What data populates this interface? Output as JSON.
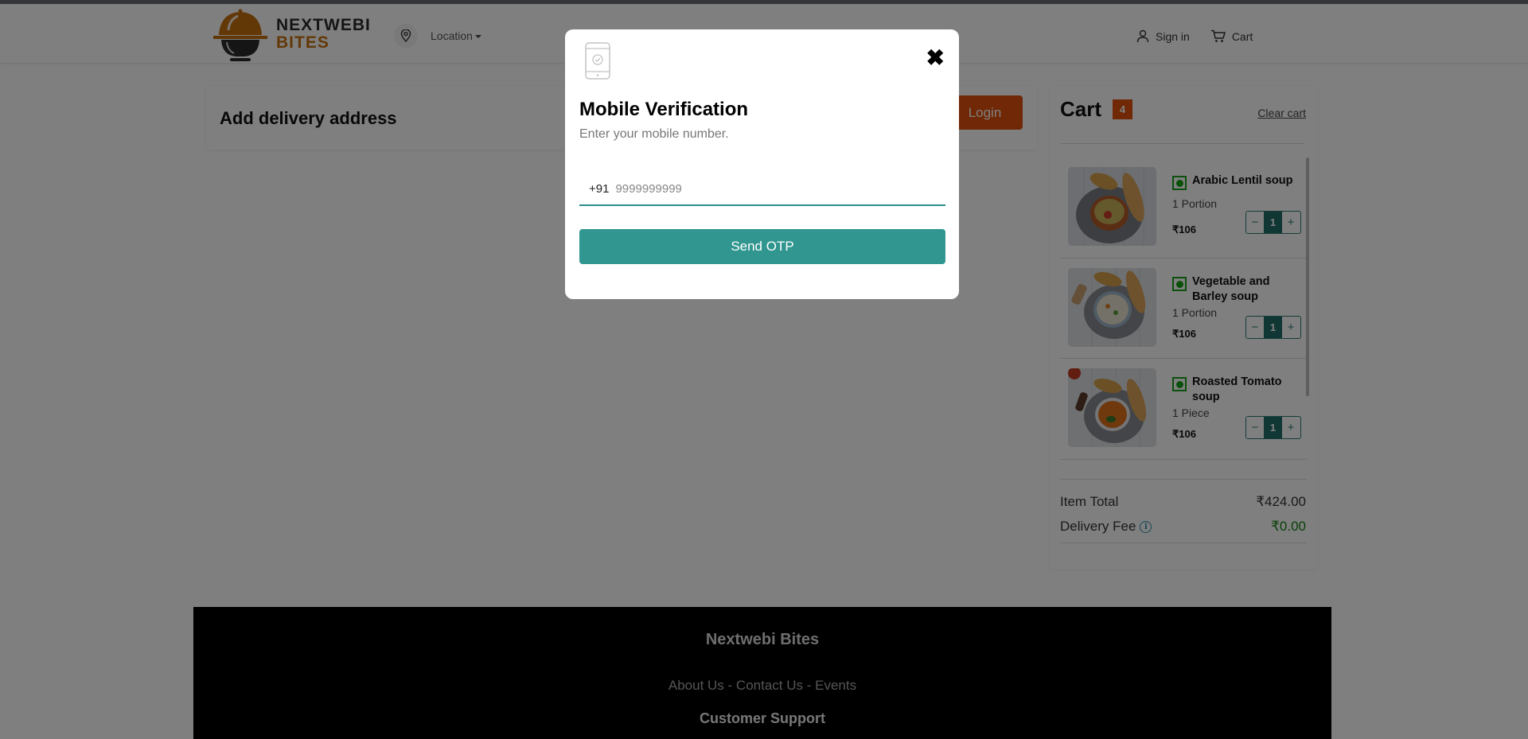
{
  "header": {
    "logo": {
      "line1": "NEXTWEBI",
      "line2": "BITES"
    },
    "location_label": "Location",
    "sign_in_label": "Sign in",
    "cart_label": "Cart"
  },
  "address": {
    "title": "Add delivery address",
    "login_label": "Login"
  },
  "cart": {
    "title": "Cart",
    "count": "4",
    "clear_label": "Clear cart",
    "items": [
      {
        "name": "Arabic Lentil soup",
        "unit": "1 Portion",
        "price": "₹106",
        "qty": "1",
        "veg": true
      },
      {
        "name": "Vegetable and Barley soup",
        "unit": "1 Portion",
        "price": "₹106",
        "qty": "1",
        "veg": true
      },
      {
        "name": "Roasted Tomato soup",
        "unit": "1 Piece",
        "price": "₹106",
        "qty": "1",
        "veg": true
      }
    ],
    "stepper": {
      "minus": "−",
      "plus": "+"
    },
    "summary": {
      "item_total_label": "Item Total",
      "item_total_value": "₹424.00",
      "delivery_fee_label": "Delivery Fee",
      "delivery_fee_value": "₹0.00"
    }
  },
  "footer": {
    "brand": "Nextwebi Bites",
    "links": [
      "About Us",
      "Contact Us",
      "Events"
    ],
    "separator": " - ",
    "support_heading": "Customer Support"
  },
  "modal": {
    "icon": "mobile-verified-icon",
    "title": "Mobile Verification",
    "subtitle": "Enter your mobile number.",
    "country_code": "+91",
    "phone_value": "",
    "phone_placeholder": "9999999999",
    "send_label": "Send OTP",
    "close_symbol": "✖"
  },
  "colors": {
    "brand_orange": "#e0500c",
    "teal": "#30968f",
    "veg_green": "#1a9e1a",
    "free_green": "#108010"
  }
}
